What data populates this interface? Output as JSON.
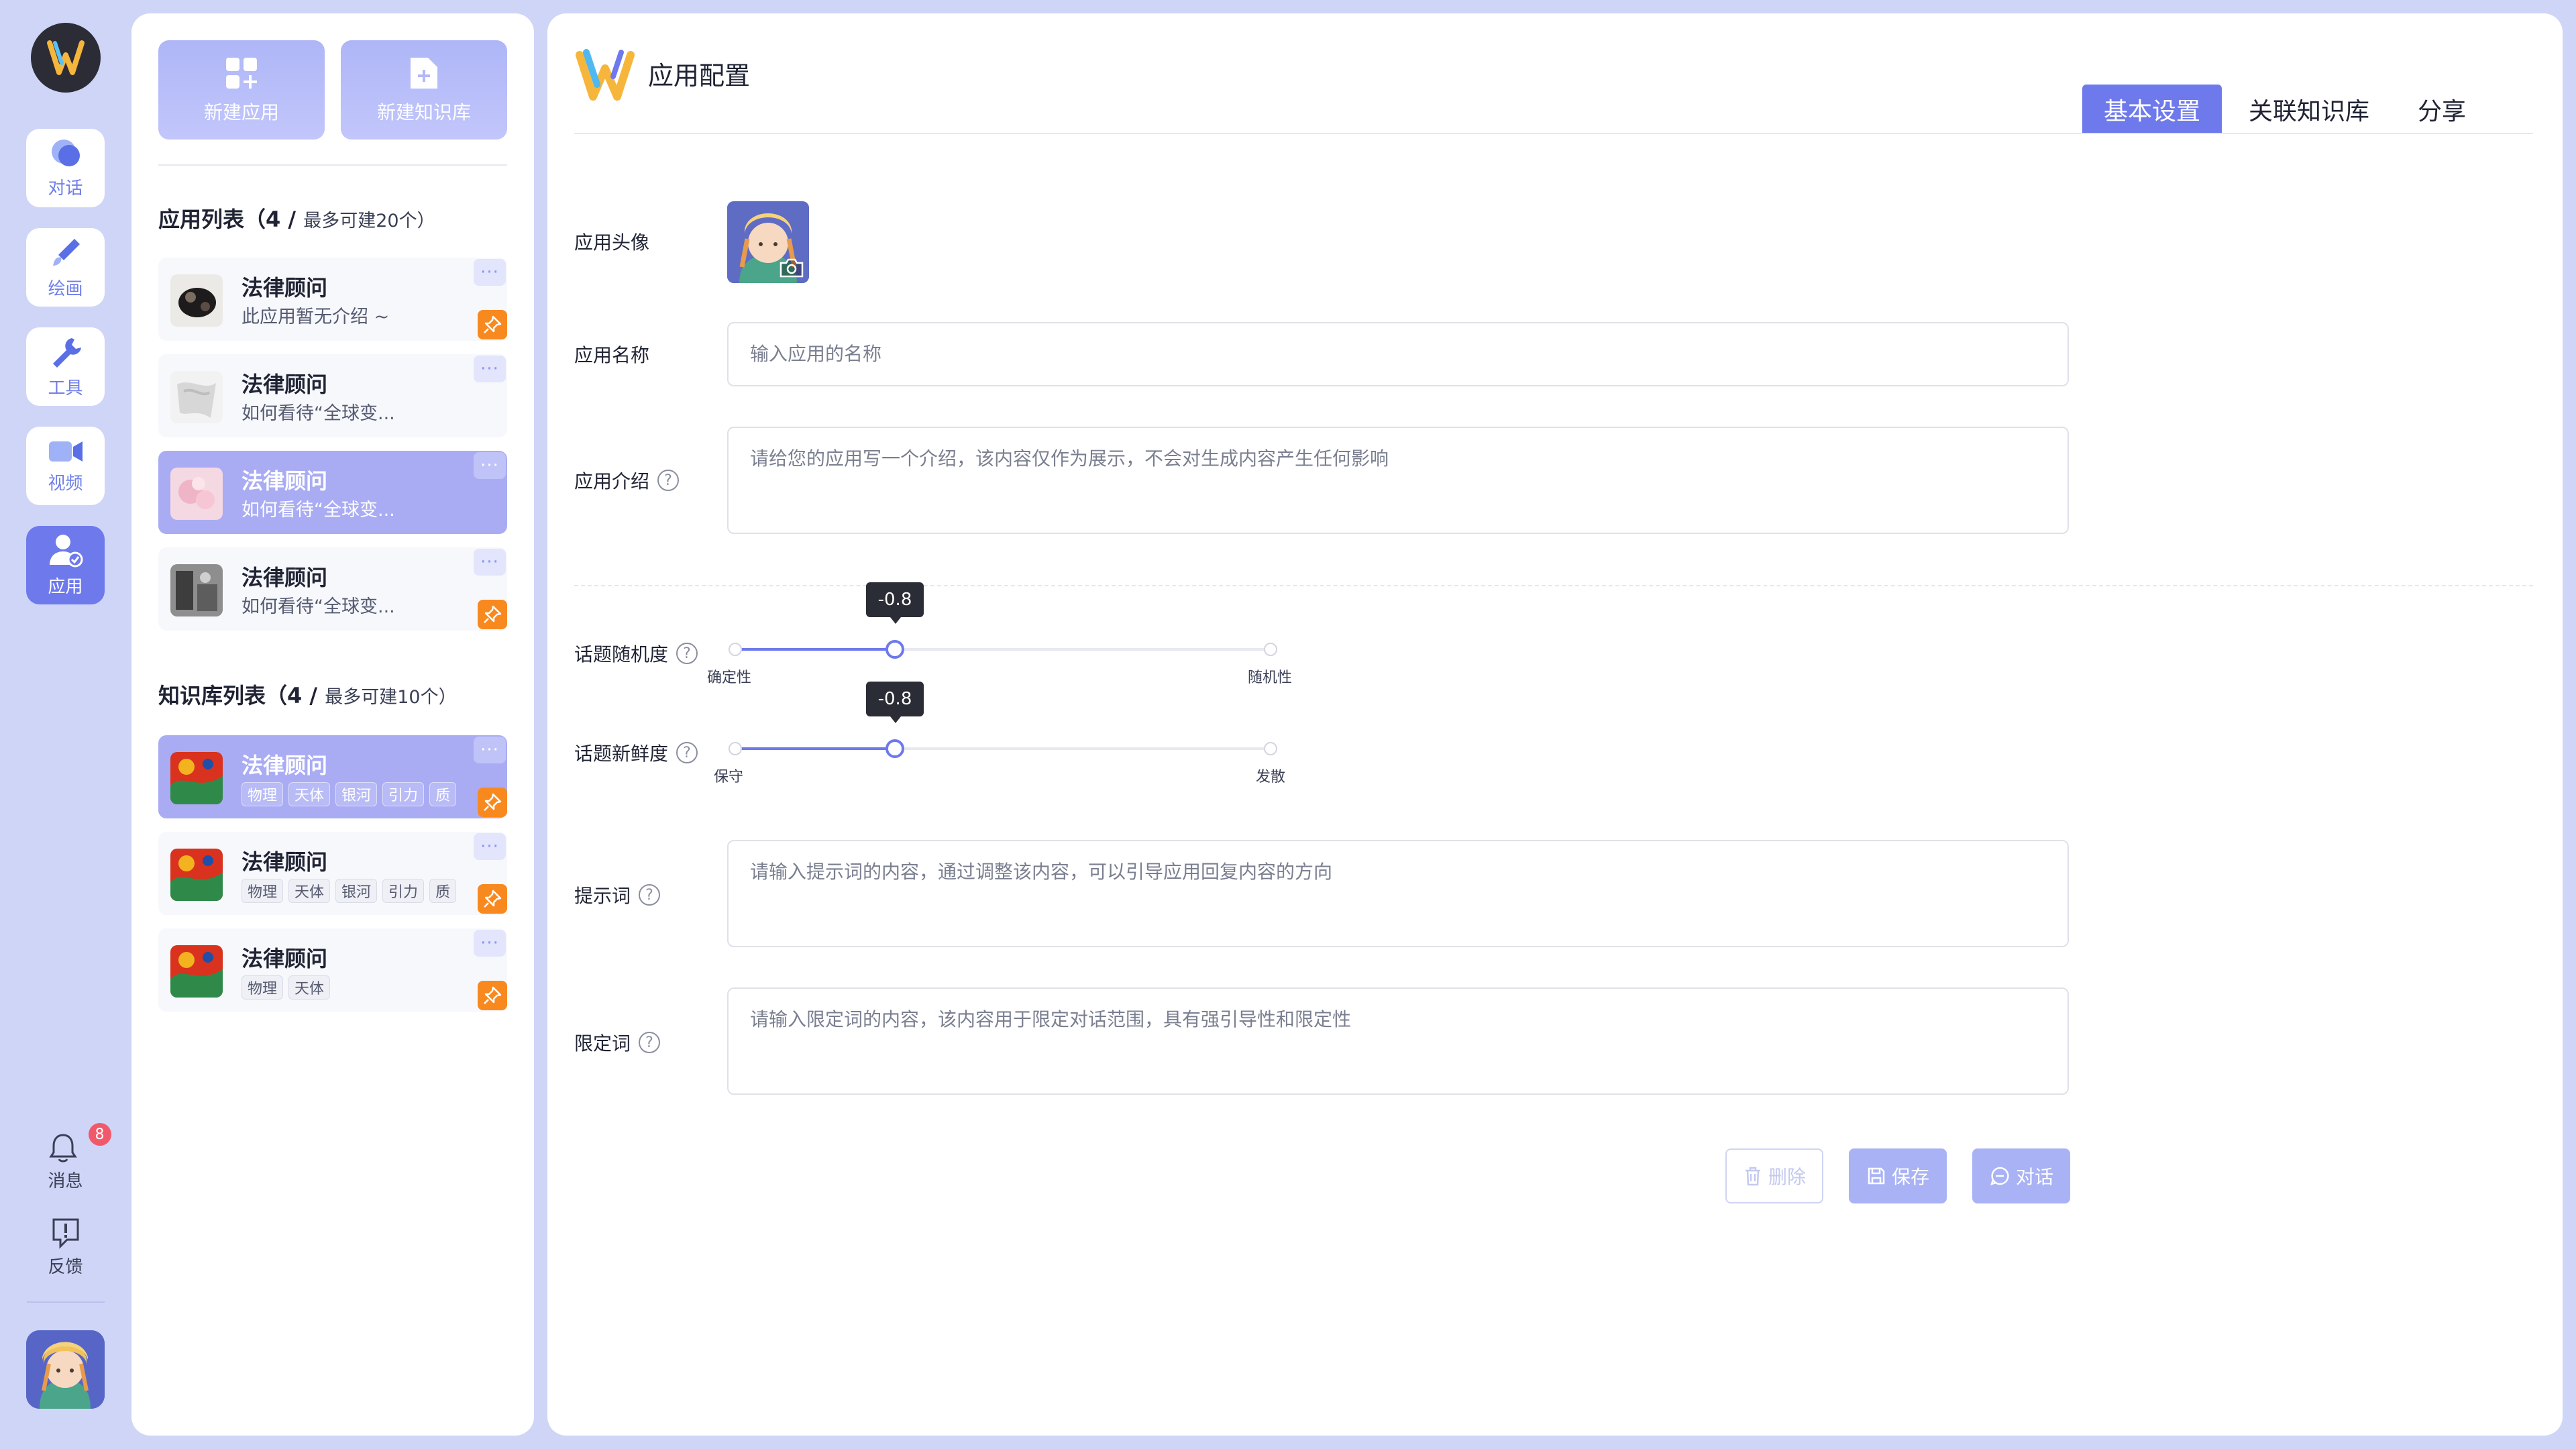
{
  "rail": {
    "items": [
      {
        "label": "对话"
      },
      {
        "label": "绘画"
      },
      {
        "label": "工具"
      },
      {
        "label": "视频"
      },
      {
        "label": "应用"
      }
    ],
    "messages": {
      "label": "消息",
      "badge": "8"
    },
    "feedback": {
      "label": "反馈"
    }
  },
  "side": {
    "new_app": "新建应用",
    "new_kb": "新建知识库",
    "app_list_title": "应用列表（4 / ",
    "app_list_sub": "最多可建20个）",
    "apps": [
      {
        "title": "法律顾问",
        "desc": "此应用暂无介绍 ~"
      },
      {
        "title": "法律顾问",
        "desc": "如何看待“全球变..."
      },
      {
        "title": "法律顾问",
        "desc": "如何看待“全球变..."
      },
      {
        "title": "法律顾问",
        "desc": "如何看待“全球变..."
      }
    ],
    "kb_list_title": "知识库列表（4 / ",
    "kb_list_sub": "最多可建10个）",
    "kbs": [
      {
        "title": "法律顾问",
        "tags": [
          "物理",
          "天体",
          "银河",
          "引力",
          "质"
        ]
      },
      {
        "title": "法律顾问",
        "tags": [
          "物理",
          "天体",
          "银河",
          "引力",
          "质"
        ]
      },
      {
        "title": "法律顾问",
        "tags": [
          "物理",
          "天体"
        ]
      }
    ],
    "more_glyph": "···"
  },
  "main": {
    "title": "应用配置",
    "tabs": [
      "基本设置",
      "关联知识库",
      "分享"
    ],
    "avatar_label": "应用头像",
    "name_label": "应用名称",
    "name_placeholder": "输入应用的名称",
    "intro_label": "应用介绍",
    "intro_placeholder": "请给您的应用写一个介绍，该内容仅作为展示，不会对生成内容产生任何影响",
    "randomness": {
      "label": "话题随机度",
      "value": -0.8,
      "value_text": "-0.8",
      "min_label": "确定性",
      "max_label": "随机性",
      "min": -2,
      "max": 2
    },
    "freshness": {
      "label": "话题新鲜度",
      "value": -0.8,
      "value_text": "-0.8",
      "min_label": "保守",
      "max_label": "发散",
      "min": -2,
      "max": 2
    },
    "prompt_label": "提示词",
    "prompt_placeholder": "请输入提示词的内容，通过调整该内容，可以引导应用回复内容的方向",
    "limit_label": "限定词",
    "limit_placeholder": "请输入限定词的内容，该内容用于限定对话范围，具有强引导性和限定性",
    "delete": "删除",
    "save": "保存",
    "chat": "对话",
    "help_glyph": "?"
  },
  "colors": {
    "accent": "#6e79ec",
    "pin": "#f8891f",
    "badge": "#f1596b"
  }
}
